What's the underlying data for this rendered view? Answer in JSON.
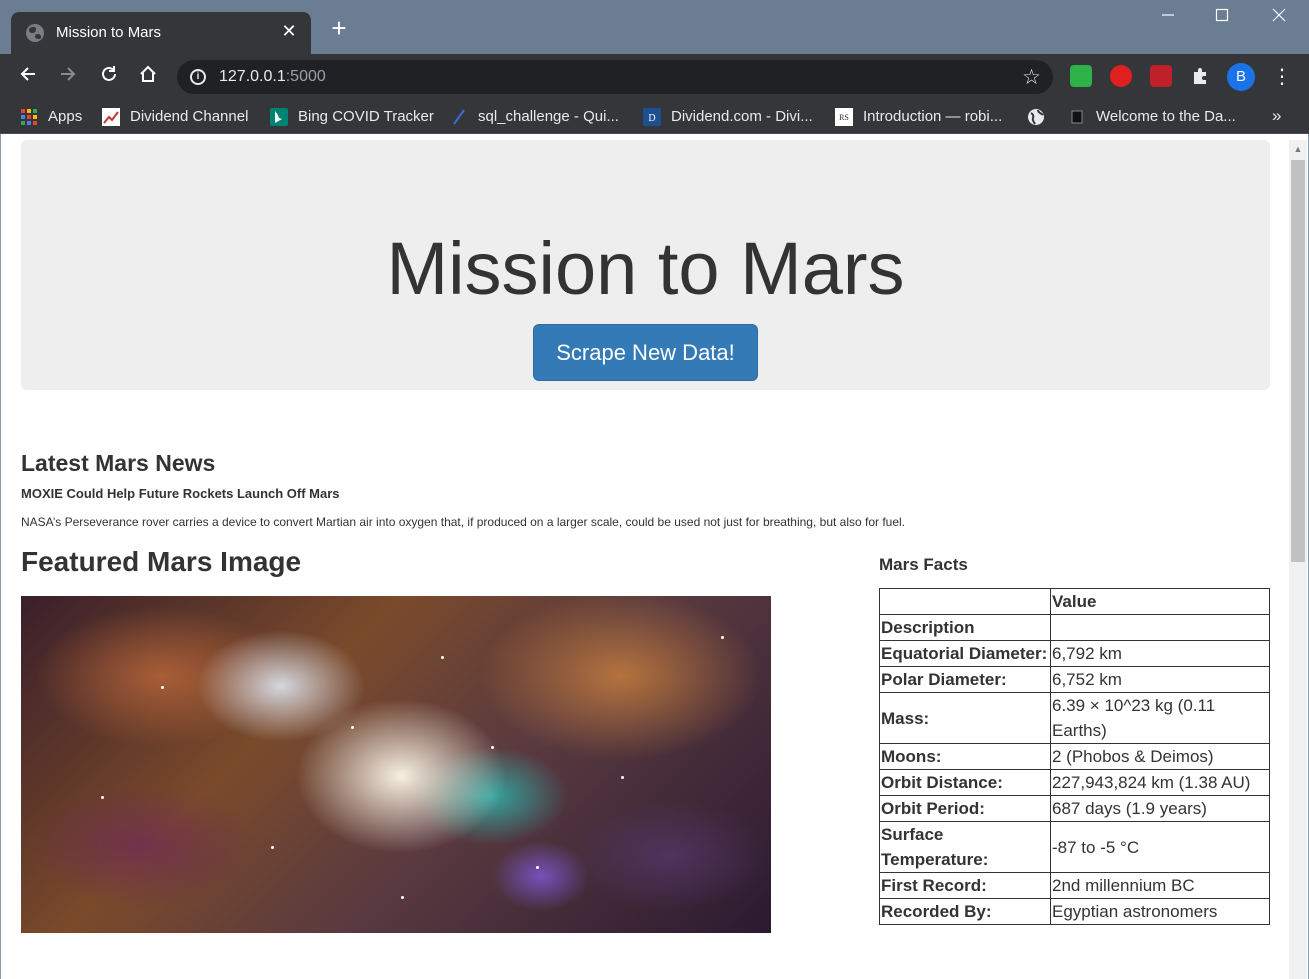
{
  "browser": {
    "tab_title": "Mission to Mars",
    "url_host": "127.0.0.1",
    "url_port": ":5000",
    "profile_initial": "B",
    "bookmarks": [
      {
        "label": "Apps",
        "icon": "apps-grid-icon"
      },
      {
        "label": "Dividend Channel",
        "icon": "dividend-channel-icon"
      },
      {
        "label": "Bing COVID Tracker",
        "icon": "bing-icon"
      },
      {
        "label": "sql_challenge - Qui...",
        "icon": "quickdbd-icon"
      },
      {
        "label": "Dividend.com - Divi...",
        "icon": "dividend-com-icon"
      },
      {
        "label": "Introduction — robi...",
        "icon": "robinhood-docs-icon"
      },
      {
        "label": "",
        "icon": "globe-icon"
      },
      {
        "label": "Welcome to the Da...",
        "icon": "book-icon"
      }
    ],
    "colors": {
      "titlebar": "#6b7d92",
      "toolbar": "#35363a",
      "profile": "#1a73e8"
    }
  },
  "page": {
    "title": "Mission to Mars",
    "scrape_button": "Scrape New Data!",
    "news_heading": "Latest Mars News",
    "news_title": "MOXIE Could Help Future Rockets Launch Off Mars",
    "news_paragraph": "NASA’s Perseverance rover carries a device to convert Martian air into oxygen that, if produced on a larger scale, could be used not just for breathing, but also for fuel.",
    "featured_heading": "Featured Mars Image",
    "facts_heading": "Mars Facts",
    "facts_table": {
      "header": [
        "",
        "Value"
      ],
      "rows": [
        {
          "label": "Description",
          "value": ""
        },
        {
          "label": "Equatorial Diameter:",
          "value": "6,792 km"
        },
        {
          "label": "Polar Diameter:",
          "value": "6,752 km"
        },
        {
          "label": "Mass:",
          "value": "6.39 × 10^23 kg (0.11 Earths)"
        },
        {
          "label": "Moons:",
          "value": "2 (Phobos & Deimos)"
        },
        {
          "label": "Orbit Distance:",
          "value": "227,943,824 km (1.38 AU)"
        },
        {
          "label": "Orbit Period:",
          "value": "687 days (1.9 years)"
        },
        {
          "label": "Surface Temperature:",
          "value": "-87 to -5 °C"
        },
        {
          "label": "First Record:",
          "value": "2nd millennium BC"
        },
        {
          "label": "Recorded By:",
          "value": "Egyptian astronomers"
        }
      ]
    },
    "colors": {
      "button": "#337ab7",
      "jumbotron": "#eeeeee",
      "text": "#333333"
    }
  }
}
